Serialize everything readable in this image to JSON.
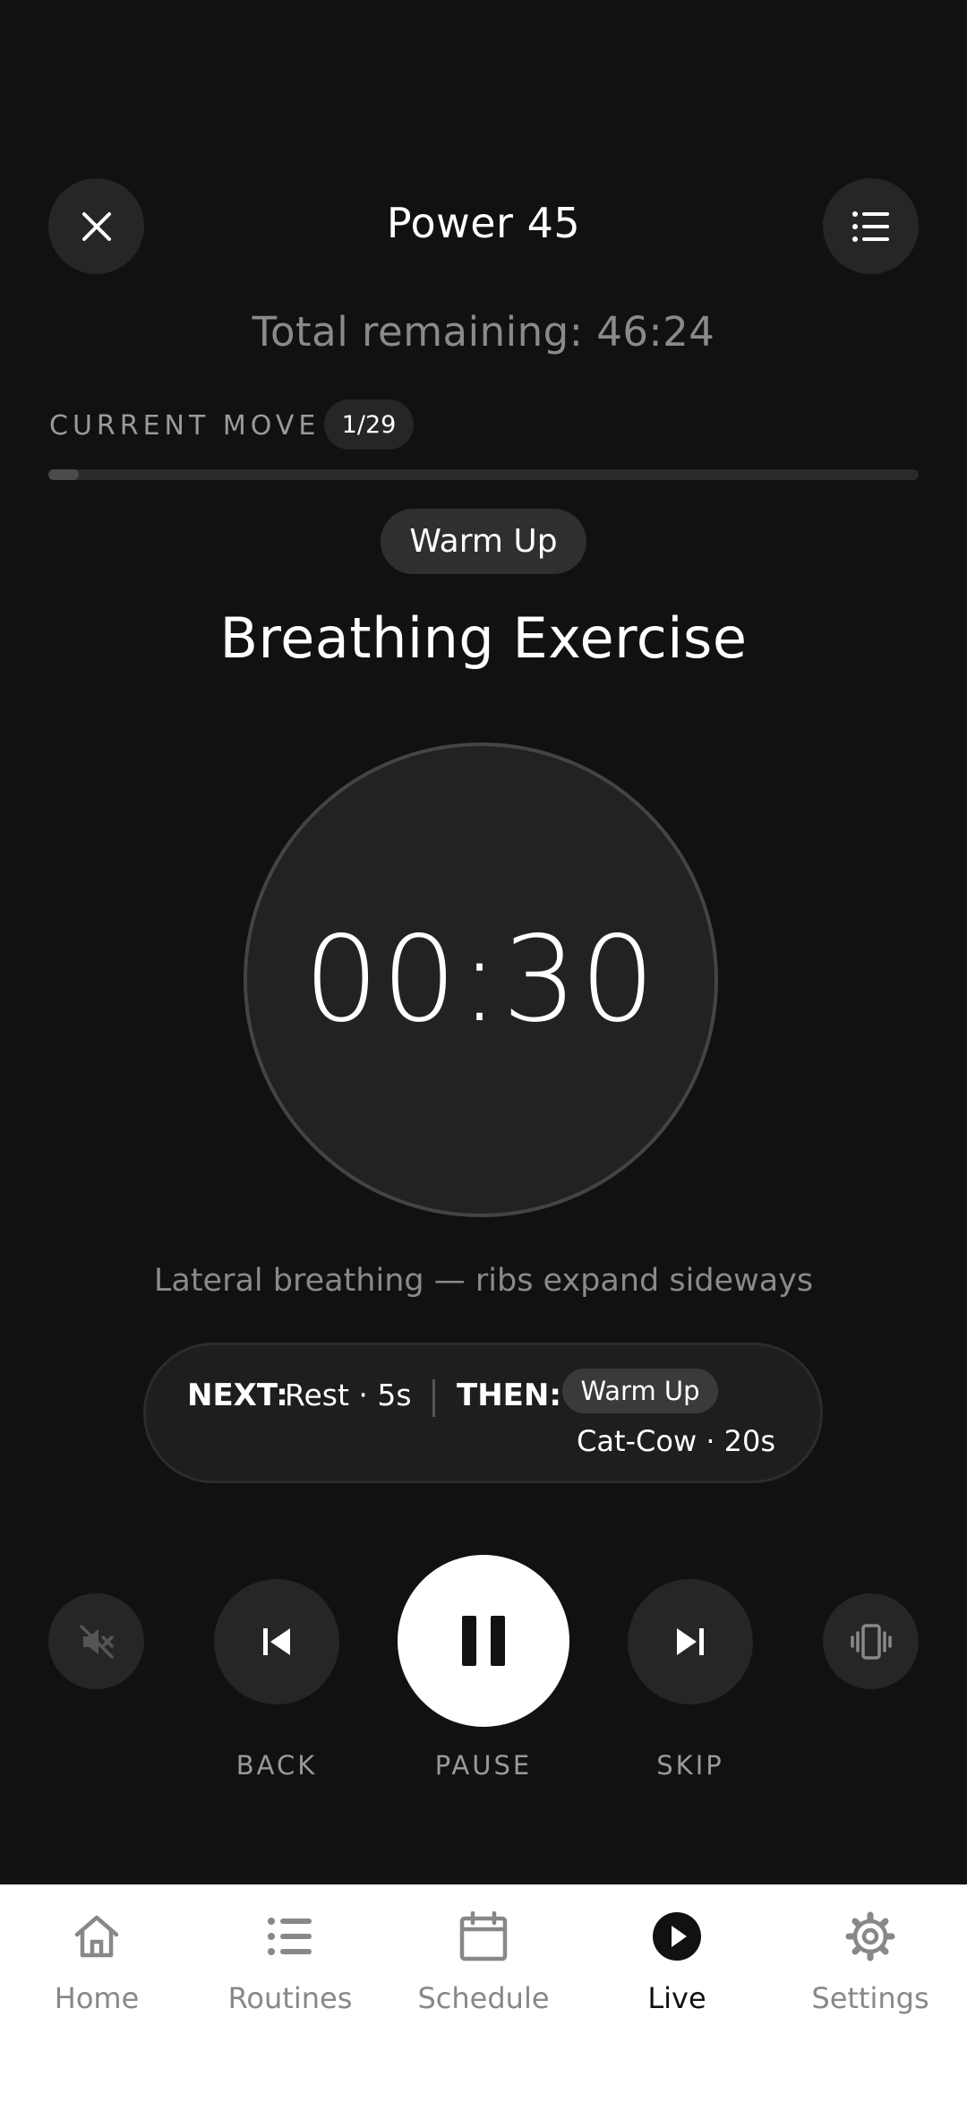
{
  "header": {
    "title": "Power 45",
    "total_remaining": "Total remaining: 46:24"
  },
  "progress": {
    "label": "CURRENT MOVE",
    "counter": "1/29",
    "current": 1,
    "total": 29
  },
  "current_move": {
    "phase": "Warm Up",
    "name": "Breathing Exercise",
    "timer": "00:30",
    "cue": "Lateral breathing — ribs expand sideways"
  },
  "up_next": {
    "next_label": "NEXT:",
    "next_value": "Rest · 5s",
    "then_label": "THEN:",
    "then_phase": "Warm Up",
    "then_value": "Cat-Cow · 20s"
  },
  "controls": {
    "back_label": "BACK",
    "pause_label": "PAUSE",
    "skip_label": "SKIP",
    "mute_icon": "speaker-muted-icon",
    "vibrate_icon": "vibrate-icon"
  },
  "nav": {
    "items": [
      {
        "label": "Home",
        "icon": "home-icon",
        "active": false
      },
      {
        "label": "Routines",
        "icon": "list-icon",
        "active": false
      },
      {
        "label": "Schedule",
        "icon": "calendar-icon",
        "active": false
      },
      {
        "label": "Live",
        "icon": "play-circle-icon",
        "active": true
      },
      {
        "label": "Settings",
        "icon": "gear-icon",
        "active": false
      }
    ]
  },
  "colors": {
    "background": "#111111",
    "surface": "#262626",
    "accent": "#ffffff",
    "muted_text": "#8a8a8a"
  }
}
